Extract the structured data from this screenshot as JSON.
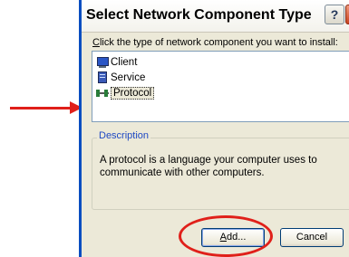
{
  "dialog": {
    "title": "Select Network Component Type",
    "help_glyph": "?",
    "close_glyph": "✕",
    "instruction_first_letter": "C",
    "instruction_rest": "lick the type of network component you want to install:",
    "items": [
      {
        "label": "Client",
        "icon": "client-monitor-icon",
        "selected": false
      },
      {
        "label": "Service",
        "icon": "service-computer-icon",
        "selected": false
      },
      {
        "label": "Protocol",
        "icon": "protocol-network-icon",
        "selected": true
      }
    ],
    "description_legend": "Description",
    "description_text": "A protocol is a language your computer uses to communicate with other computers.",
    "add_button_first": "A",
    "add_button_rest": "dd...",
    "cancel_button": "Cancel"
  },
  "annotations": {
    "arrow_color": "#e0201a",
    "ellipse_color": "#e0201a"
  },
  "colors": {
    "dialog_bg": "#ece9d8",
    "window_border": "#0a4ec0",
    "legend_text": "#1f49c3",
    "close_button": "#c9431f"
  }
}
